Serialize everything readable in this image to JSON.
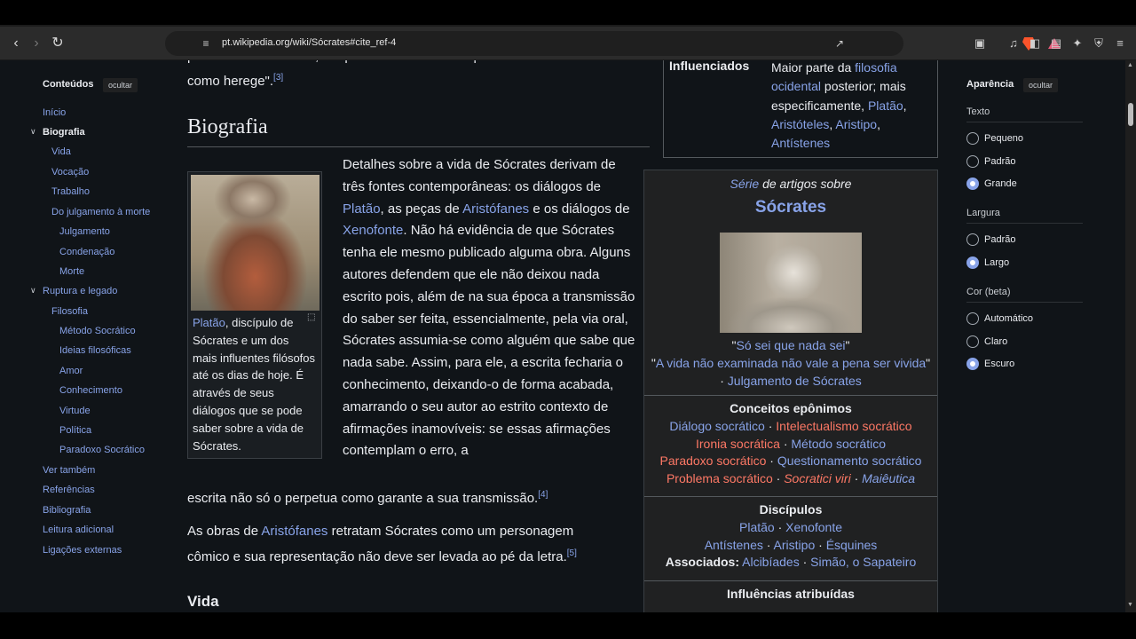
{
  "browser": {
    "url_domain": "pt.wikipedia.org",
    "url_path": "/wiki/Sócrates#cite_ref-4",
    "icons": [
      "back-icon",
      "forward-icon",
      "reload-icon",
      "bookmark-icon",
      "site-info-icon",
      "share-icon",
      "brave-shield-icon",
      "rewards-icon",
      "screenshot-icon",
      "media-icon",
      "sidebar-icon",
      "wallet-icon",
      "leo-icon",
      "vpn-icon",
      "menu-icon"
    ]
  },
  "toc": {
    "title": "Conteúdos",
    "hide_label": "ocultar",
    "items": [
      {
        "label": "Início"
      },
      {
        "label": "Biografia"
      },
      {
        "label": "Vida"
      },
      {
        "label": "Vocação"
      },
      {
        "label": "Trabalho"
      },
      {
        "label": "Do julgamento à morte"
      },
      {
        "label": "Julgamento"
      },
      {
        "label": "Condenação"
      },
      {
        "label": "Morte"
      },
      {
        "label": "Ruptura e legado"
      },
      {
        "label": "Filosofia"
      },
      {
        "label": "Método Socrático"
      },
      {
        "label": "Ideias filosóficas"
      },
      {
        "label": "Amor"
      },
      {
        "label": "Conhecimento"
      },
      {
        "label": "Virtude"
      },
      {
        "label": "Política"
      },
      {
        "label": "Paradoxo Socrático"
      },
      {
        "label": "Ver também"
      },
      {
        "label": "Referências"
      },
      {
        "label": "Bibliografia"
      },
      {
        "label": "Leitura adicional"
      },
      {
        "label": "Ligações externas"
      }
    ]
  },
  "article": {
    "top_partial": "profeta de \"Deus-Sol\", um professor condenado por seus ensinamentos",
    "top_line2": "como herege\".",
    "top_ref": "[3]",
    "heading": "Biografia",
    "p1": {
      "t1": "Detalhes sobre a vida de Sócrates derivam de três fontes contemporâneas: os diálogos de ",
      "l1": "Platão",
      "t2": ", as peças de ",
      "l2": "Aristófanes",
      "t3": " e os diálogos de ",
      "l3": "Xenofonte",
      "t4": ". Não há evidência de que Sócrates tenha ele mesmo publicado alguma obra. Alguns autores defendem que ele não deixou nada escrito pois, além de na sua época a transmissão do saber ser feita, essencialmente, pela via oral, Sócrates assumia-se como alguém que sabe que nada sabe. Assim, para ele, a escrita fecharia o conhecimento, deixando-o de forma acabada, amarrando o seu autor ao estrito contexto de afirmações inamovíveis: se essas afirmações contemplam o erro, a",
      "last_line": "escrita não só o perpetua como garante a sua transmissão.",
      "ref": "[4]"
    },
    "p2": {
      "t1": "As obras de ",
      "l1": "Aristófanes",
      "t2": " retratam Sócrates como um personagem cômico e sua representação não deve ser levada ao pé da letra.",
      "ref": "[5]"
    },
    "subheading": "Vida",
    "thumb": {
      "link": "Platão",
      "caption": ", discípulo de Sócrates e um dos mais influentes filósofos até os dias de hoje. É através de seus diálogos que se pode saber sobre a vida de Sócrates."
    }
  },
  "infobox": {
    "label": "Influenciados",
    "value_pre": "Maior parte da ",
    "value_link": "filosofia ocidental",
    "value_mid": " posterior; mais especificamente, ",
    "links": [
      "Platão",
      "Aristóteles",
      "Aristipo",
      "Antístenes"
    ]
  },
  "series": {
    "intro_link": "Série",
    "intro_rest": " de artigos sobre",
    "title": "Sócrates",
    "quote1": "Só sei que nada sei",
    "quote2": "A vida não examinada não vale a pena ser vivida",
    "trial": "Julgamento de Sócrates",
    "concepts_head": "Conceitos epônimos",
    "concepts": {
      "c1": "Diálogo socrático",
      "c2": "Intelectualismo socrático",
      "c3": "Ironia socrática",
      "c4": "Método socrático",
      "c5": "Paradoxo socrático",
      "c6": "Questionamento socrático",
      "c7": "Problema socrático",
      "c8": "Socratici viri",
      "c9": "Maiêutica"
    },
    "disciples_head": "Discípulos",
    "disciples": {
      "d1": "Platão",
      "d2": "Xenofonte",
      "d3": "Antístenes",
      "d4": "Aristipo",
      "d5": "Ésquines"
    },
    "associates_label": "Associados:",
    "associates": {
      "a1": "Alcibíades",
      "a2": "Simão, o Sapateiro"
    },
    "influences_head": "Influências atribuídas"
  },
  "appearance": {
    "title": "Aparência",
    "hide_label": "ocultar",
    "text_label": "Texto",
    "text_options": [
      "Pequeno",
      "Padrão",
      "Grande"
    ],
    "text_selected": "Grande",
    "width_label": "Largura",
    "width_options": [
      "Padrão",
      "Largo"
    ],
    "width_selected": "Largo",
    "color_label": "Cor (beta)",
    "color_options": [
      "Automático",
      "Claro",
      "Escuro"
    ],
    "color_selected": "Escuro"
  },
  "colors": {
    "link": "#88a3e8",
    "redlink": "#fd7865",
    "page_bg": "#101418",
    "text": "#eaecf0"
  }
}
